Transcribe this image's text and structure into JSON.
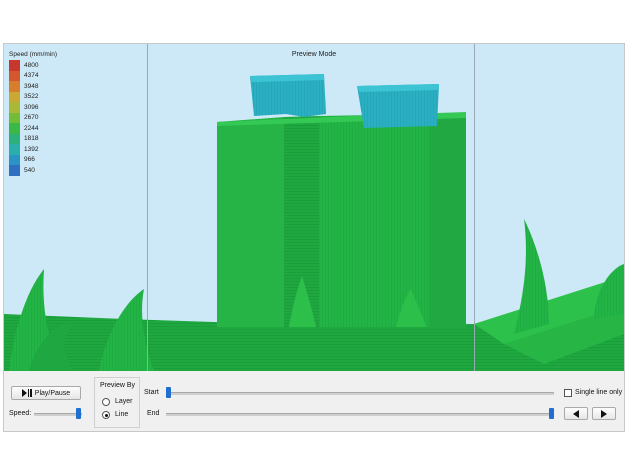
{
  "viewport": {
    "title": "Preview Mode",
    "legend": {
      "title": "Speed (mm/min)",
      "items": [
        {
          "label": "4800",
          "color": "#c8372d"
        },
        {
          "label": "4374",
          "color": "#d5572d"
        },
        {
          "label": "3948",
          "color": "#d77e2e"
        },
        {
          "label": "3522",
          "color": "#c9a833"
        },
        {
          "label": "3096",
          "color": "#a9b837"
        },
        {
          "label": "2670",
          "color": "#72bd38"
        },
        {
          "label": "2244",
          "color": "#3bb845"
        },
        {
          "label": "1818",
          "color": "#2db17a"
        },
        {
          "label": "1392",
          "color": "#2aafad"
        },
        {
          "label": "966",
          "color": "#2c94c4"
        },
        {
          "label": "540",
          "color": "#2e6fc0"
        }
      ]
    }
  },
  "controls": {
    "play_pause_label": "Play/Pause",
    "speed_label": "Speed:",
    "preview_by": {
      "title": "Preview By",
      "options": [
        "Layer",
        "Line"
      ],
      "selected": "Line"
    },
    "start_label": "Start",
    "end_label": "End",
    "single_line_only_label": "Single line only",
    "single_line_only_checked": false,
    "start_position": 0.0,
    "end_position": 1.0
  }
}
